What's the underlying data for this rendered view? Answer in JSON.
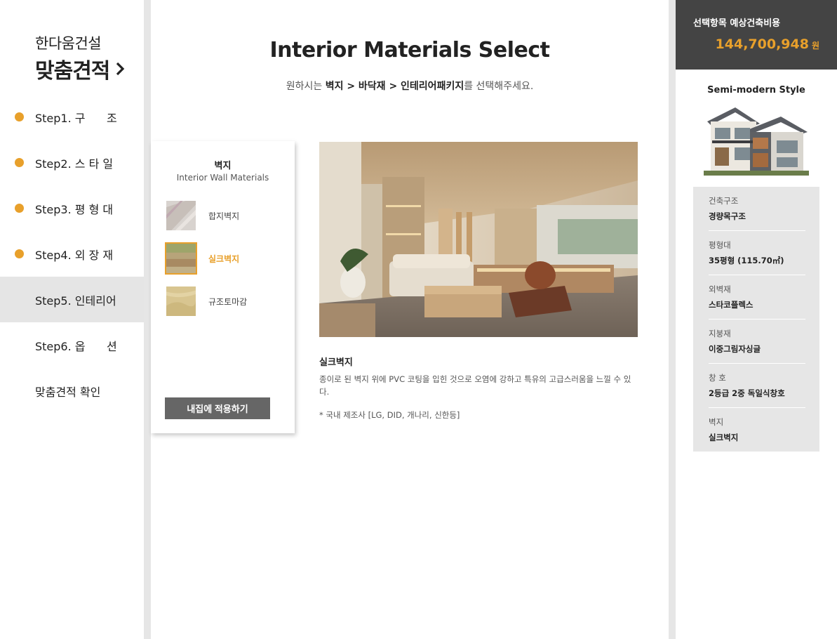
{
  "sidebar": {
    "company": "한다움건설",
    "title": "맞춤견적",
    "steps": [
      {
        "label": "Step1. 구      조",
        "done": true
      },
      {
        "label": "Step2. 스 타 일",
        "done": true
      },
      {
        "label": "Step3. 평 형 대",
        "done": true
      },
      {
        "label": "Step4. 외 장 재",
        "done": true
      },
      {
        "label": "Step5. 인테리어",
        "active": true
      },
      {
        "label": "Step6. 옵      션"
      },
      {
        "label": "맞춤견적 확인"
      }
    ]
  },
  "main": {
    "title": "Interior Materials Select",
    "subtitle_prefix": "원하시는 ",
    "subtitle_path": "벽지 > 바닥재 > 인테리어패키지",
    "subtitle_suffix": "를 선택해주세요.",
    "panel": {
      "title": "벽지",
      "subtitle": "Interior Wall Materials",
      "materials": [
        {
          "name": "합지벽지",
          "swatch": "#cfcac5"
        },
        {
          "name": "실크벽지",
          "swatch": "#b9a878",
          "selected": true
        },
        {
          "name": "규조토마감",
          "swatch": "#d9c48c"
        }
      ],
      "apply_label": "내집에 적용하기"
    },
    "description": {
      "title": "실크벽지",
      "text": "종이로 된 벽지 위에 PVC 코팅을 입힌 것으로 오염에 강하고 특유의 고급스러움을 느낄 수 있다.",
      "note": "* 국내 제조사 [LG, DID, 개나리, 신한등]"
    }
  },
  "summary": {
    "cost_label": "선택항목 예상건축비용",
    "cost_value": "144,700,948",
    "cost_unit": "원",
    "style_name": "Semi-modern Style",
    "specs": [
      {
        "label": "건축구조",
        "value": "경량목구조"
      },
      {
        "label": "평형대",
        "value": "35평형 (115.70㎡)"
      },
      {
        "label": "외벽재",
        "value": "스타코플렉스"
      },
      {
        "label": "지붕재",
        "value": "이중그림자싱글"
      },
      {
        "label": "창 호",
        "value": "2등급 2중 독일식창호"
      },
      {
        "label": "벽지",
        "value": "실크벽지"
      }
    ]
  },
  "colors": {
    "accent": "#e8a02b",
    "dark": "#444444",
    "gray": "#e6e6e6"
  }
}
